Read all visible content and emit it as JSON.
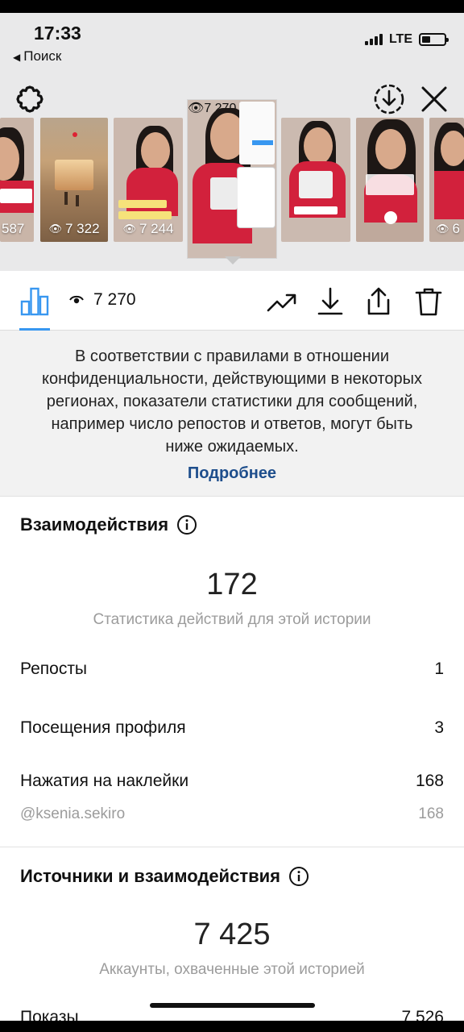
{
  "status_bar": {
    "time": "17:33",
    "back_label": "Поиск",
    "network": "LTE"
  },
  "thumbnails": [
    {
      "views": "587"
    },
    {
      "views": "7 322"
    },
    {
      "views": "7 244"
    },
    {
      "views": "7 270",
      "selected": true
    },
    {
      "views": ""
    },
    {
      "views": ""
    },
    {
      "views": "6"
    }
  ],
  "action_bar": {
    "views": "7 270"
  },
  "notice": {
    "text": "В соответствии с правилами в отношении конфиденциальности, действующими в некоторых регионах, показатели статистики для сообщений, например число репостов и ответов, могут быть ниже ожидаемых.",
    "link": "Подробнее"
  },
  "interactions": {
    "title": "Взаимодействия",
    "total": "172",
    "subtitle": "Статистика действий для этой истории",
    "rows": [
      {
        "label": "Репосты",
        "value": "1"
      },
      {
        "label": "Посещения профиля",
        "value": "3"
      },
      {
        "label": "Нажатия на наклейки",
        "value": "168"
      },
      {
        "label": "@ksenia.sekiro",
        "value": "168"
      }
    ]
  },
  "reach": {
    "title": "Источники и взаимодействия",
    "total": "7 425",
    "subtitle": "Аккаунты, охваченные этой историей",
    "partial_row": {
      "label": "Показы",
      "value": "7 526"
    }
  },
  "colors": {
    "accent": "#3897f0",
    "link": "#1e4e8c",
    "muted": "#9c9c9c"
  }
}
